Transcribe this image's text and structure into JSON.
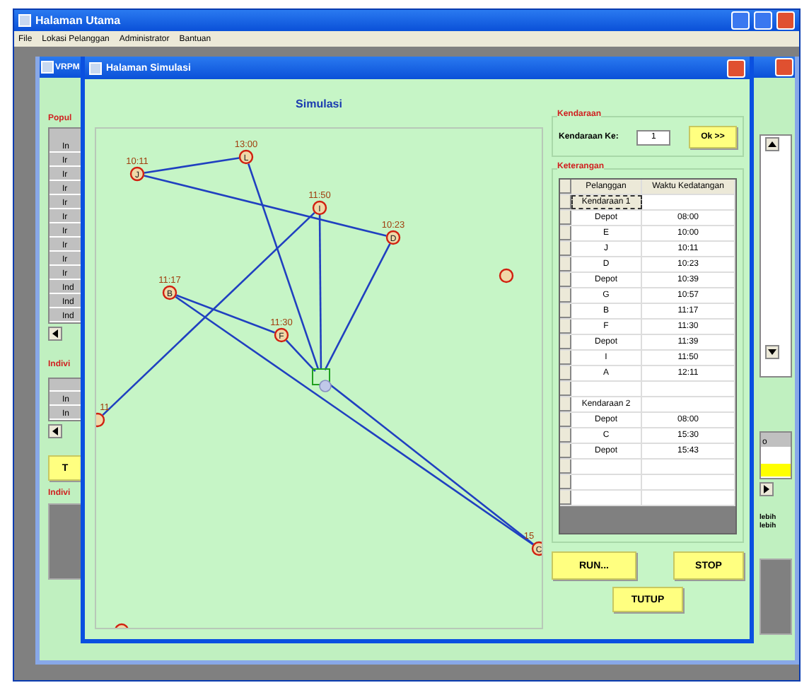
{
  "main_window": {
    "title": "Halaman Utama"
  },
  "menu": [
    "File",
    "Lokasi Pelanggan",
    "Administrator",
    "Bantuan"
  ],
  "back_window": {
    "title": "VRPM",
    "left": {
      "group_1": "Popul",
      "rows": [
        "In",
        "Ir",
        "Ir",
        "Ir",
        "Ir",
        "Ir",
        "Ir",
        "Ir",
        "Ir",
        "Ir",
        "Ind",
        "Ind",
        "Ind"
      ],
      "group_2": "Indivi",
      "rows_2": [
        "In",
        "In"
      ],
      "button": "T",
      "group_3": "Indivi"
    },
    "right": {
      "header": "o",
      "notes": [
        "lebih",
        "lebih"
      ]
    }
  },
  "simulation_window": {
    "title": "Halaman Simulasi",
    "heading": "Simulasi",
    "nodes": [
      {
        "kind": "labeled",
        "letter": "J",
        "time": "10:11"
      },
      {
        "kind": "labeled",
        "letter": "L",
        "time": "13:00"
      },
      {
        "kind": "labeled",
        "letter": "I",
        "time": "11:50"
      },
      {
        "kind": "labeled",
        "letter": "D",
        "time": "10:23"
      },
      {
        "kind": "plain"
      },
      {
        "kind": "labeled",
        "letter": "B",
        "time": "11:17"
      },
      {
        "kind": "labeled",
        "letter": "F",
        "time": "11:30"
      },
      {
        "kind": "labeled",
        "time": "11"
      },
      {
        "kind": "labeled",
        "letter": "C",
        "time": "15"
      },
      {
        "kind": "plain"
      }
    ],
    "vehicle_group": {
      "title": "Kendaraan",
      "label": "Kendaraan Ke:",
      "value": "1",
      "button": "Ok >>"
    },
    "info_group": {
      "title": "Keterangan",
      "columns": [
        "Pelanggan",
        "Waktu Kedatangan"
      ],
      "rows": [
        {
          "kind": "vehicle",
          "customer": "Kendaraan 1",
          "focused": true
        },
        {
          "kind": "stop",
          "customer": "Depot",
          "time": "08:00"
        },
        {
          "kind": "stop",
          "customer": "E",
          "time": "10:00"
        },
        {
          "kind": "stop",
          "customer": "J",
          "time": "10:11"
        },
        {
          "kind": "stop",
          "customer": "D",
          "time": "10:23"
        },
        {
          "kind": "stop",
          "customer": "Depot",
          "time": "10:39"
        },
        {
          "kind": "stop",
          "customer": "G",
          "time": "10:57"
        },
        {
          "kind": "stop",
          "customer": "B",
          "time": "11:17"
        },
        {
          "kind": "stop",
          "customer": "F",
          "time": "11:30"
        },
        {
          "kind": "stop",
          "customer": "Depot",
          "time": "11:39"
        },
        {
          "kind": "stop",
          "customer": "I",
          "time": "11:50"
        },
        {
          "kind": "stop",
          "customer": "A",
          "time": "12:11"
        },
        {
          "kind": "blank"
        },
        {
          "kind": "vehicle",
          "customer": "Kendaraan 2",
          "focused": false
        },
        {
          "kind": "stop",
          "customer": "Depot",
          "time": "08:00"
        },
        {
          "kind": "stop",
          "customer": "C",
          "time": "15:30"
        },
        {
          "kind": "stop",
          "customer": "Depot",
          "time": "15:43"
        }
      ]
    },
    "buttons": [
      "RUN...",
      "STOP",
      "TUTUP"
    ]
  }
}
